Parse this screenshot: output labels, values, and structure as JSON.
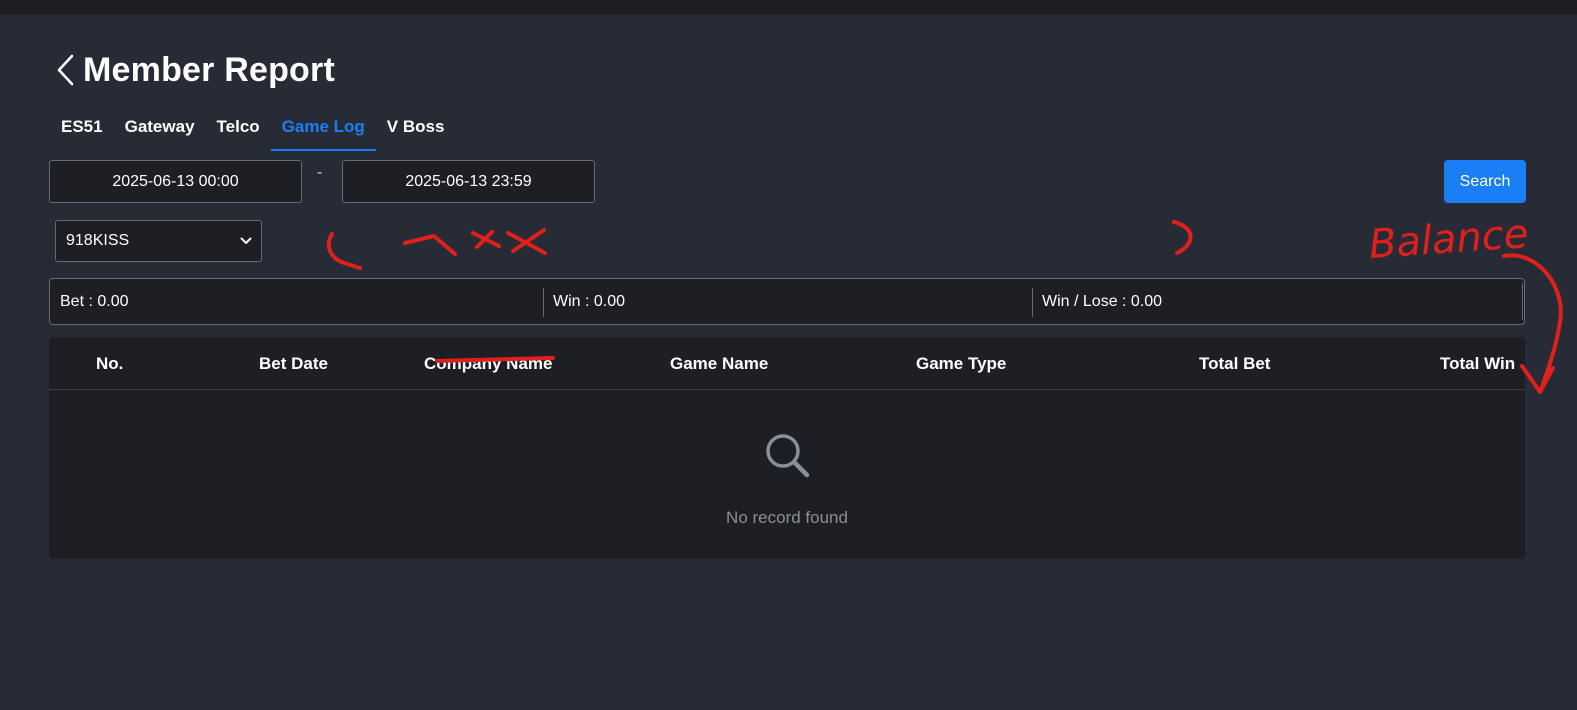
{
  "header": {
    "title": "Member Report",
    "back_icon": "chevron-left-icon"
  },
  "tabs": [
    {
      "label": "ES51",
      "active": false
    },
    {
      "label": "Gateway",
      "active": false
    },
    {
      "label": "Telco",
      "active": false
    },
    {
      "label": "Game Log",
      "active": true
    },
    {
      "label": "V Boss",
      "active": false
    }
  ],
  "filters": {
    "date_from": "2025-06-13 00:00",
    "date_separator": "-",
    "date_to": "2025-06-13 23:59",
    "search_label": "Search",
    "provider_selected": "918KISS",
    "provider_icon": "chevron-down-icon"
  },
  "summary": {
    "bet": "Bet : 0.00",
    "win": "Win : 0.00",
    "win_lose": "Win / Lose : 0.00"
  },
  "table": {
    "columns": [
      "No.",
      "Bet Date",
      "Company Name",
      "Game Name",
      "Game Type",
      "Total Bet",
      "Total Win"
    ],
    "rows": [],
    "empty_icon": "search-icon",
    "empty_text": "No record found"
  },
  "annotations": {
    "handwritten_note": "Balance",
    "color": "#e0201c"
  },
  "colors": {
    "background": "#272b35",
    "panel": "#1e1f24",
    "accent": "#1a7ff5",
    "border": "#666a74",
    "muted_text": "#8a8e97"
  }
}
